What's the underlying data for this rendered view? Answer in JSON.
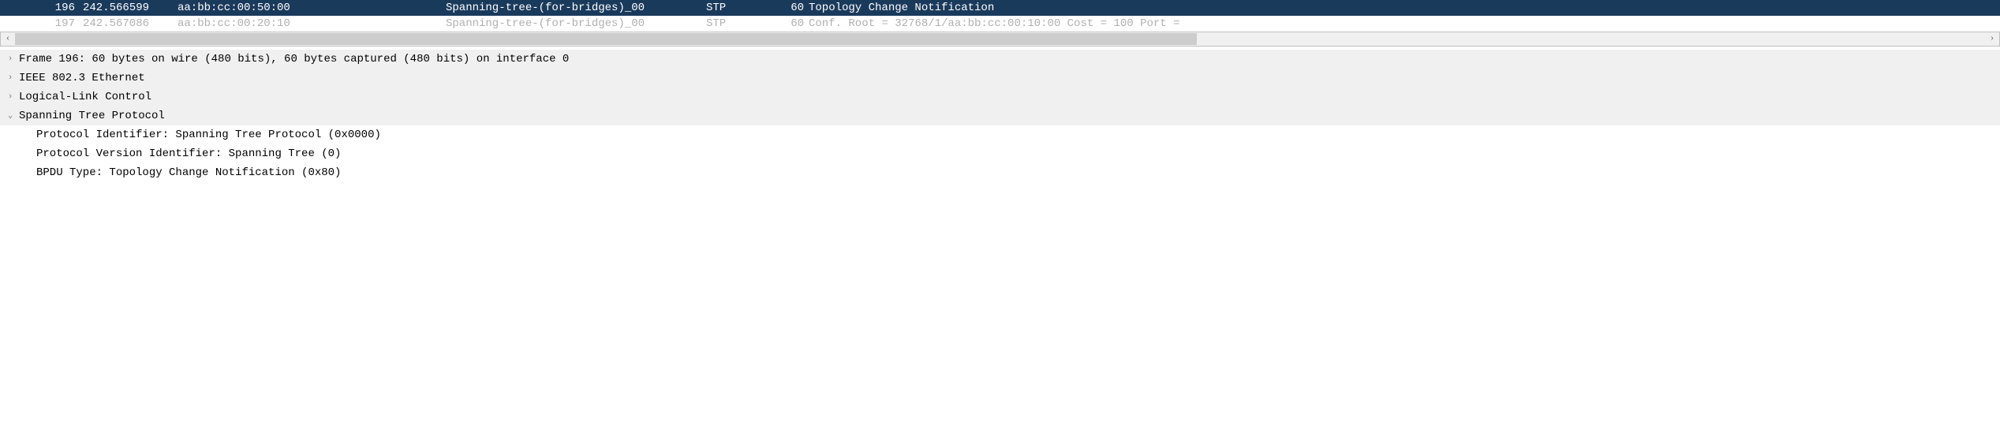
{
  "packets": [
    {
      "no": "196",
      "time": "242.566599",
      "source": "aa:bb:cc:00:50:00",
      "destination": "Spanning-tree-(for-bridges)_00",
      "protocol": "STP",
      "length": "60",
      "info": "Topology Change Notification",
      "selected": true,
      "ignored": false
    },
    {
      "no": "197",
      "time": "242.567086",
      "source": "aa:bb:cc:00:20:10",
      "destination": "Spanning-tree-(for-bridges)_00",
      "protocol": "STP",
      "length": "60",
      "info": "Conf. Root = 32768/1/aa:bb:cc:00:10:00  Cost = 100  Port =",
      "selected": false,
      "ignored": true
    }
  ],
  "details": {
    "frame": "Frame 196: 60 bytes on wire (480 bits), 60 bytes captured (480 bits) on interface 0",
    "ethernet": "IEEE 802.3 Ethernet",
    "llc": "Logical-Link Control",
    "stp_header": "Spanning Tree Protocol",
    "stp_fields": {
      "protocol_identifier": "Protocol Identifier: Spanning Tree Protocol (0x0000)",
      "protocol_version": "Protocol Version Identifier: Spanning Tree (0)",
      "bpdu_type": "BPDU Type: Topology Change Notification (0x80)"
    }
  },
  "carets": {
    "collapsed": "›",
    "expanded": "⌄"
  }
}
